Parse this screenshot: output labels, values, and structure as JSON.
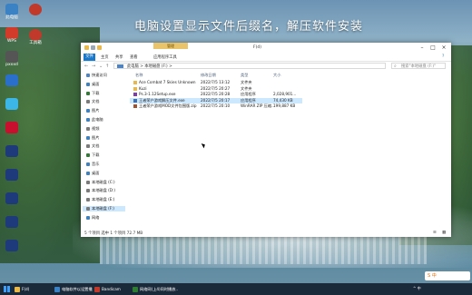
{
  "banner": "电脑设置显示文件后缀名，解压软件安装",
  "desktop_icons": [
    {
      "label": "此电脑",
      "color": "#3b82c4"
    },
    {
      "label": "WPS",
      "color": "#d23a2a"
    },
    {
      "label": "pxxxd",
      "color": "#555"
    },
    {
      "label": "",
      "color": "#2a6fc9"
    },
    {
      "label": "",
      "color": "#3cb6e6"
    },
    {
      "label": "",
      "color": "#c8102e"
    },
    {
      "label": "",
      "color": "#1e3a7a"
    },
    {
      "label": "",
      "color": "#1e3a7a"
    },
    {
      "label": "",
      "color": "#1e3a7a"
    },
    {
      "label": "",
      "color": "#1e3a7a"
    },
    {
      "label": "",
      "color": "#1e3a7a"
    }
  ],
  "right_icons": [
    {
      "label": "",
      "color": "#c0392b"
    },
    {
      "label": "工具箱",
      "color": "#c0392b"
    }
  ],
  "window": {
    "context_tab": "管理",
    "title": "F(d)",
    "ribbon_tabs": [
      "文件",
      "主页",
      "共享",
      "查看",
      "应用程序工具"
    ],
    "address": "此电脑 > 本地磁盘 (F:) >",
    "search_placeholder": "搜索\"本地磁盘 (F:)\"",
    "nav": [
      {
        "label": "快速访问",
        "color": "#4a86c7"
      },
      {
        "label": "桌面",
        "color": "#3b82c4"
      },
      {
        "label": "下载",
        "color": "#2e7d32"
      },
      {
        "label": "文档",
        "color": "#7a7a7a"
      },
      {
        "label": "图片",
        "color": "#3b82c4"
      },
      {
        "label": "此电脑",
        "color": "#3b82c4"
      },
      {
        "label": "视频",
        "color": "#7a7a7a"
      },
      {
        "label": "图片",
        "color": "#3b82c4"
      },
      {
        "label": "文档",
        "color": "#7a7a7a"
      },
      {
        "label": "下载",
        "color": "#2e7d32"
      },
      {
        "label": "音乐",
        "color": "#3b82c4"
      },
      {
        "label": "桌面",
        "color": "#3b82c4"
      },
      {
        "label": "本地磁盘 (C:)",
        "color": "#7a7a7a"
      },
      {
        "label": "本地磁盘 (D:)",
        "color": "#7a7a7a"
      },
      {
        "label": "本地磁盘 (E:)",
        "color": "#7a7a7a"
      },
      {
        "label": "本地磁盘 (F:)",
        "color": "#7a7a7a"
      },
      {
        "label": "网络",
        "color": "#3b82c4"
      }
    ],
    "selected_nav": 15,
    "columns": [
      "名称",
      "修改日期",
      "类型",
      "大小"
    ],
    "files": [
      {
        "name": "Ace Combat 7 Skies Unknown",
        "date": "2022/7/5 13:12",
        "type": "文件夹",
        "size": "",
        "color": "#e8b84a"
      },
      {
        "name": "Kuzi",
        "date": "2022/7/5 20:27",
        "type": "文件夹",
        "size": "",
        "color": "#e8b84a"
      },
      {
        "name": "Ps.3-1.12Setup.exe",
        "date": "2022/7/5 20:28",
        "type": "应用程序",
        "size": "2,028,901...",
        "color": "#7a3fa0"
      },
      {
        "name": "王者荣户游戏解压文件.exe",
        "date": "2022/7/5 20:17",
        "type": "应用程序",
        "size": "74,430 KB",
        "color": "#3b6fb6"
      },
      {
        "name": "王者荣户游戏MOD文件包围版.zip",
        "date": "2022/7/5 20:10",
        "type": "WinRAR ZIP 压缩...",
        "size": "199,887 KB",
        "color": "#a0522d"
      }
    ],
    "highlighted_file": 3,
    "status": "5 个项目    选中 1 个项目  72.7 MB"
  },
  "taskbar": {
    "tasks": [
      {
        "label": "F(d)",
        "color": "#e8b84a"
      },
      {
        "label": "电脑软件以设置播放...",
        "color": "#3b82c4"
      },
      {
        "label": "Bandicam",
        "color": "#c0392b"
      },
      {
        "label": "网络网(上4)同时播放...",
        "color": "#2e7d32"
      }
    ],
    "tray": "^ 中",
    "time": "",
    "date": ""
  },
  "ime_label": "S 中"
}
